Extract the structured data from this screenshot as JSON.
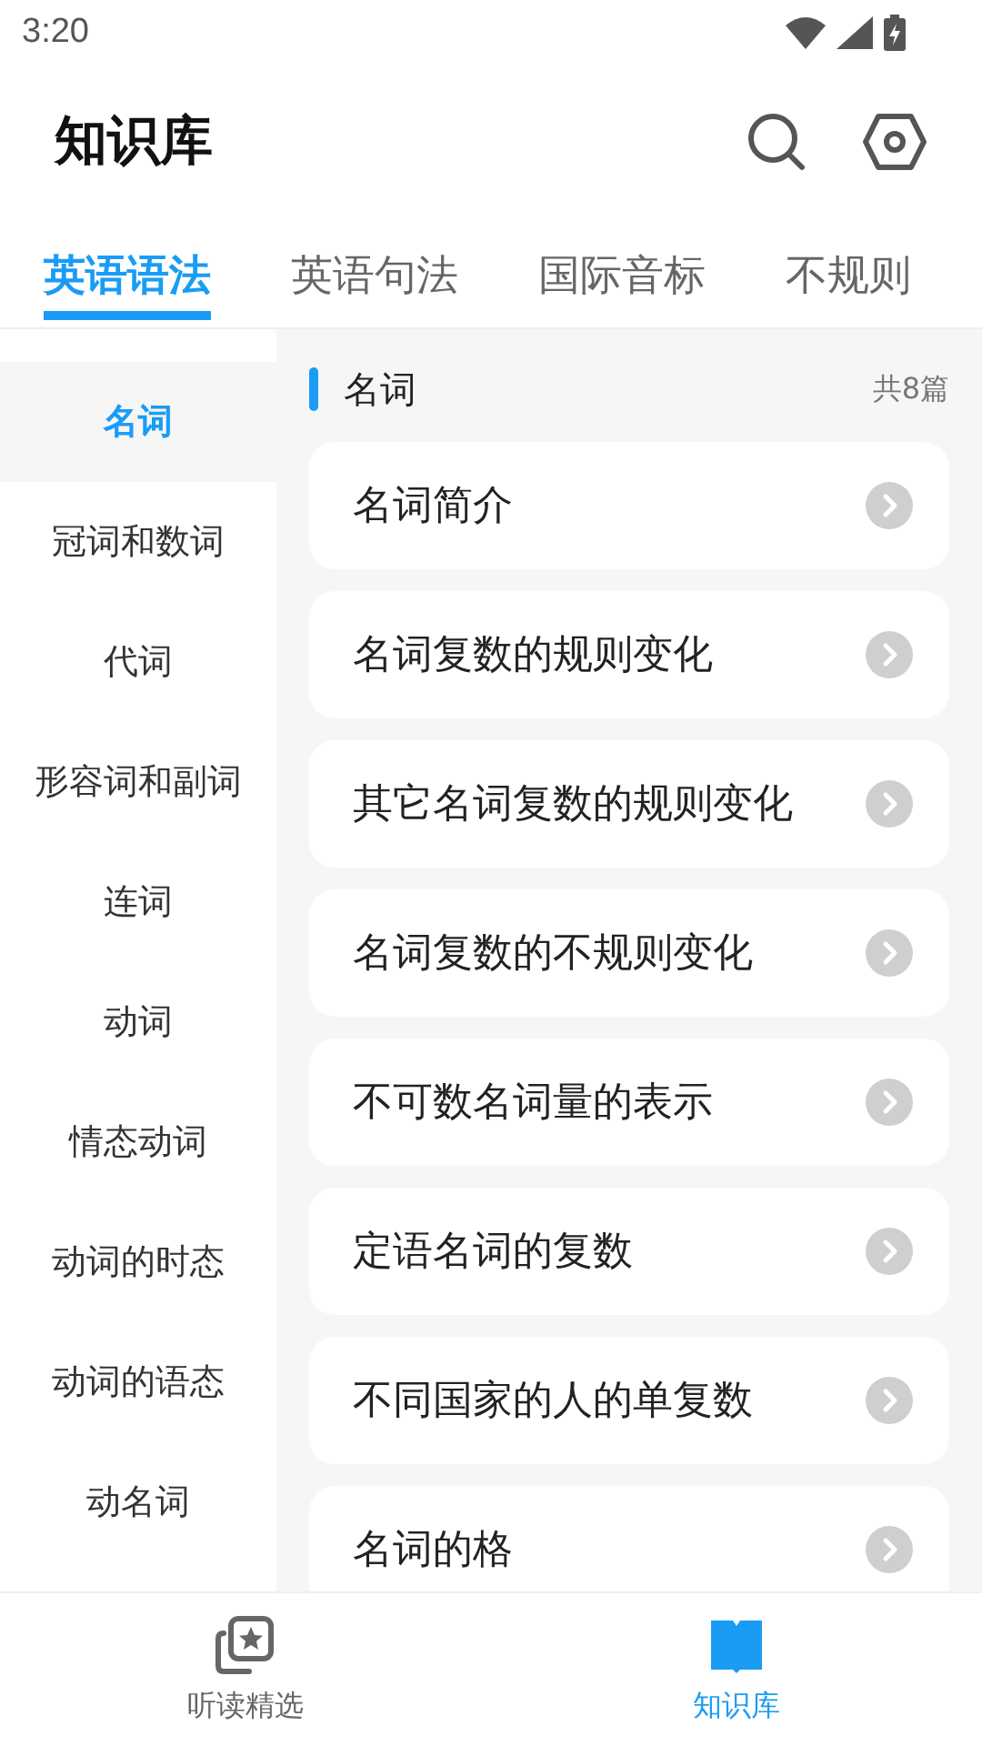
{
  "status_bar": {
    "time": "3:20"
  },
  "header": {
    "title": "知识库"
  },
  "tabs": [
    {
      "label": "英语语法",
      "selected": true
    },
    {
      "label": "英语句法",
      "selected": false
    },
    {
      "label": "国际音标",
      "selected": false
    },
    {
      "label": "不规则",
      "selected": false
    }
  ],
  "sidebar": {
    "items": [
      {
        "label": "名词",
        "selected": true
      },
      {
        "label": "冠词和数词",
        "selected": false
      },
      {
        "label": "代词",
        "selected": false
      },
      {
        "label": "形容词和副词",
        "selected": false
      },
      {
        "label": "连词",
        "selected": false
      },
      {
        "label": "动词",
        "selected": false
      },
      {
        "label": "情态动词",
        "selected": false
      },
      {
        "label": "动词的时态",
        "selected": false
      },
      {
        "label": "动词的语态",
        "selected": false
      },
      {
        "label": "动名词",
        "selected": false
      }
    ]
  },
  "section": {
    "title": "名词",
    "count": "共8篇"
  },
  "articles": [
    "名词简介",
    "名词复数的规则变化",
    "其它名词复数的规则变化",
    "名词复数的不规则变化",
    "不可数名词量的表示",
    "定语名词的复数",
    "不同国家的人的单复数",
    "名词的格"
  ],
  "bottom_nav": [
    {
      "label": "听读精选",
      "kind": "featured",
      "selected": false
    },
    {
      "label": "知识库",
      "kind": "library",
      "selected": true
    }
  ]
}
